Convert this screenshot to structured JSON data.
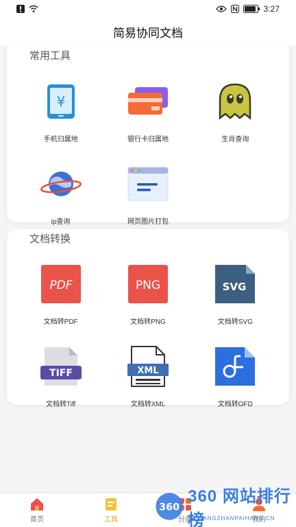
{
  "status_bar": {
    "time": "3:27"
  },
  "header": {
    "title": "简易协同文档"
  },
  "tools": {
    "title": "常用工具",
    "items": [
      {
        "label": "手机归属地",
        "icon": "phone-yuan-icon"
      },
      {
        "label": "银行卡归属地",
        "icon": "bank-card-icon"
      },
      {
        "label": "生肖查询",
        "icon": "ghost-icon"
      },
      {
        "label": "ip查询",
        "icon": "planet-icon"
      },
      {
        "label": "网页图片打包",
        "icon": "webpage-icon"
      }
    ]
  },
  "convert": {
    "title": "文档转换",
    "items": [
      {
        "label": "文档转PDF",
        "badge": "PDF",
        "icon": "pdf-file-icon"
      },
      {
        "label": "文档转PNG",
        "badge": "PNG",
        "icon": "png-file-icon"
      },
      {
        "label": "文档转SVG",
        "badge": "SVG",
        "icon": "svg-file-icon"
      },
      {
        "label": "文档转Tiff",
        "badge": "TIFF",
        "icon": "tiff-file-icon"
      },
      {
        "label": "文档转XML",
        "badge": "XML",
        "icon": "xml-file-icon"
      },
      {
        "label": "文档转OFD",
        "icon": "ofd-file-icon"
      }
    ]
  },
  "tab_bar": {
    "items": [
      {
        "label": "首页",
        "icon": "home-icon"
      },
      {
        "label": "工具",
        "icon": "tools-icon",
        "active": true
      },
      {
        "label": "分类",
        "icon": "category-icon"
      },
      {
        "label": "我的",
        "icon": "profile-icon"
      }
    ]
  },
  "watermark": {
    "brand": "360 网站排行榜",
    "sub": "WANGZHANPAIHANG.CN"
  },
  "colors": {
    "accent": "#e0a020",
    "pdf": "#e9534a",
    "png": "#e9534a",
    "svg": "#3b5f7f",
    "tiff": "#5b4aa8",
    "xml": "#3f6fb5",
    "ofd": "#2b6fe0"
  }
}
